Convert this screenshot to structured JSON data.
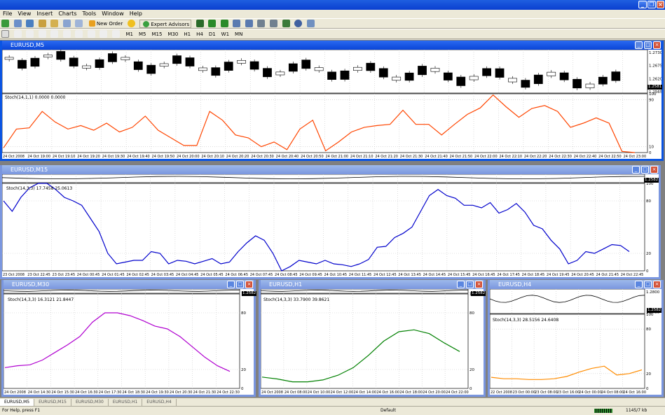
{
  "app": {
    "menu": [
      "File",
      "View",
      "Insert",
      "Charts",
      "Tools",
      "Window",
      "Help"
    ],
    "toolbar1": {
      "new_order": "New Order",
      "expert_advisors": "Expert Advisors"
    },
    "timeframes": [
      "M1",
      "M5",
      "M15",
      "M30",
      "H1",
      "H4",
      "D1",
      "W1",
      "MN"
    ]
  },
  "windows": {
    "m5": {
      "title": "EURUSD,M5",
      "indicator": "Stoch(14,1,1) 0.0000 0.0000",
      "price_box": "1.2581",
      "price_ticks": [
        "1.2730",
        "1.2675",
        "1.2620",
        "1.2565"
      ],
      "ind_ticks": [
        "100",
        "90",
        "10",
        "0"
      ],
      "time_labels": [
        "24 Oct 2008",
        "24 Oct 19:00",
        "24 Oct 19:10",
        "24 Oct 19:20",
        "24 Oct 19:30",
        "24 Oct 19:40",
        "24 Oct 19:50",
        "24 Oct 20:00",
        "24 Oct 20:10",
        "24 Oct 20:20",
        "24 Oct 20:30",
        "24 Oct 20:40",
        "24 Oct 20:50",
        "24 Oct 21:00",
        "24 Oct 21:10",
        "24 Oct 21:20",
        "24 Oct 21:30",
        "24 Oct 21:40",
        "24 Oct 21:50",
        "24 Oct 22:00",
        "24 Oct 22:10",
        "24 Oct 22:20",
        "24 Oct 22:30",
        "24 Oct 22:40",
        "24 Oct 22:50",
        "24 Oct 23:00"
      ]
    },
    "m15": {
      "title": "EURUSD,M15",
      "indicator": "Stoch(14,3,3) 17.7458 25.0613",
      "price_box": "1.2582",
      "ind_ticks": [
        "100",
        "80",
        "20",
        "0"
      ],
      "time_labels": [
        "23 Oct 2008",
        "23 Oct 22:45",
        "23 Oct 23:45",
        "24 Oct 00:45",
        "24 Oct 01:45",
        "24 Oct 02:45",
        "24 Oct 03:45",
        "24 Oct 04:45",
        "24 Oct 05:45",
        "24 Oct 06:45",
        "24 Oct 07:45",
        "24 Oct 08:45",
        "24 Oct 09:45",
        "24 Oct 10:45",
        "24 Oct 11:45",
        "24 Oct 12:45",
        "24 Oct 13:45",
        "24 Oct 14:45",
        "24 Oct 15:45",
        "24 Oct 16:45",
        "24 Oct 17:45",
        "24 Oct 18:45",
        "24 Oct 19:45",
        "24 Oct 20:45",
        "24 Oct 21:45",
        "24 Oct 22:45"
      ]
    },
    "m30": {
      "title": "EURUSD,M30",
      "indicator": "Stoch(14,3,3) 16.3121 21.8447",
      "price_box": "1.2582",
      "ind_ticks": [
        "100",
        "80",
        "20",
        "0"
      ],
      "time_labels": [
        "24 Oct 2008",
        "24 Oct 14:30",
        "24 Oct 15:30",
        "24 Oct 16:30",
        "24 Oct 17:30",
        "24 Oct 18:30",
        "24 Oct 19:30",
        "24 Oct 20:30",
        "24 Oct 21:30",
        "24 Oct 22:30"
      ]
    },
    "h1": {
      "title": "EURUSD,H1",
      "indicator": "Stoch(14,3,3) 33.7900 39.8621",
      "price_box": "1.2582",
      "ind_ticks": [
        "100",
        "80",
        "20",
        "0"
      ],
      "time_labels": [
        "24 Oct 2008",
        "24 Oct 08:00",
        "24 Oct 10:00",
        "24 Oct 12:00",
        "24 Oct 14:00",
        "24 Oct 16:00",
        "24 Oct 18:00",
        "24 Oct 20:00",
        "24 Oct 22:00"
      ]
    },
    "h4": {
      "title": "EURUSD,H4",
      "indicator": "Stoch(14,3,3) 28.5156 24.6408",
      "price_box": "1.2582",
      "price_ticks": [
        "1.2800",
        "1.2400"
      ],
      "ind_ticks": [
        "100",
        "80",
        "20",
        "0"
      ],
      "time_labels": [
        "22 Oct 2008",
        "23 Oct 00:00",
        "23 Oct 08:00",
        "23 Oct 16:00",
        "24 Oct 00:00",
        "24 Oct 08:00",
        "24 Oct 16:00"
      ]
    }
  },
  "tabs": [
    "EURUSD,M5",
    "EURUSD,M15",
    "EURUSD,M30",
    "EURUSD,H1",
    "EURUSD,H4"
  ],
  "status": {
    "help": "For Help, press F1",
    "profile": "Default",
    "traffic": "1145/7 kb"
  },
  "chart_data": [
    {
      "type": "line",
      "id": "m5_stoch",
      "color": "#ff4500",
      "ylim": [
        0,
        100
      ],
      "values": [
        8,
        40,
        42,
        70,
        52,
        40,
        46,
        38,
        50,
        35,
        43,
        62,
        38,
        25,
        12,
        12,
        70,
        55,
        30,
        25,
        10,
        18,
        5,
        40,
        55,
        3,
        18,
        35,
        43,
        46,
        48,
        72,
        48,
        48,
        30,
        48,
        65,
        76,
        98,
        78,
        60,
        75,
        80,
        70,
        43,
        50,
        59,
        50,
        2,
        0
      ]
    },
    {
      "type": "line",
      "id": "m15_stoch",
      "color": "#0000cc",
      "ylim": [
        0,
        100
      ],
      "values": [
        80,
        68,
        84,
        95,
        100,
        100,
        93,
        84,
        80,
        75,
        60,
        45,
        20,
        8,
        10,
        12,
        12,
        22,
        20,
        8,
        12,
        11,
        8,
        11,
        14,
        8,
        10,
        22,
        32,
        40,
        35,
        20,
        0,
        5,
        12,
        10,
        8,
        12,
        8,
        7,
        5,
        8,
        13,
        27,
        28,
        38,
        43,
        50,
        68,
        86,
        93,
        86,
        83,
        75,
        75,
        72,
        78,
        66,
        70,
        77,
        67,
        52,
        48,
        35,
        25,
        8,
        12,
        22,
        20,
        25,
        30,
        29,
        22
      ]
    },
    {
      "type": "line",
      "id": "m30_stoch",
      "color": "#b000d0",
      "ylim": [
        0,
        100
      ],
      "values": [
        22,
        24,
        25,
        30,
        38,
        46,
        55,
        70,
        80,
        80,
        77,
        72,
        66,
        63,
        55,
        44,
        33,
        24,
        18
      ]
    },
    {
      "type": "line",
      "id": "h1_stoch",
      "color": "#008000",
      "ylim": [
        0,
        100
      ],
      "values": [
        12,
        10,
        7,
        7,
        9,
        14,
        22,
        35,
        50,
        60,
        62,
        58,
        48,
        39
      ]
    },
    {
      "type": "line",
      "id": "h4_stoch",
      "color": "#ff8c00",
      "ylim": [
        0,
        100
      ],
      "values": [
        15,
        13,
        13,
        12,
        12,
        13,
        16,
        22,
        27,
        30,
        18,
        20,
        25
      ]
    }
  ]
}
